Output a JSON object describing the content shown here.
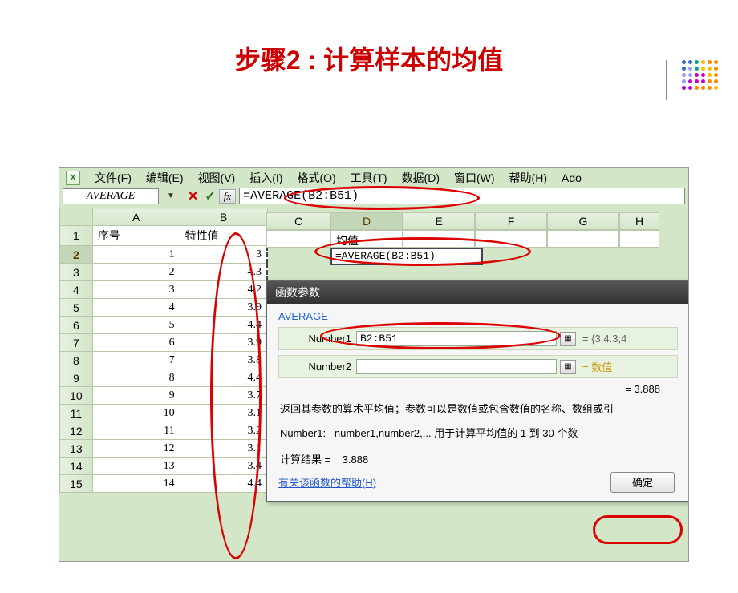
{
  "slide": {
    "title": "步骤2 : 计算样本的均值"
  },
  "menu": {
    "file": "文件(F)",
    "edit": "编辑(E)",
    "view": "视图(V)",
    "insert": "插入(I)",
    "format": "格式(O)",
    "tools": "工具(T)",
    "data": "数据(D)",
    "window": "窗口(W)",
    "help": "帮助(H)",
    "ado": "Ado"
  },
  "formulabar": {
    "namebox": "AVERAGE",
    "fx": "fx",
    "formula": "=AVERAGE(B2:B51)"
  },
  "cols": {
    "A": "A",
    "B": "B",
    "C": "C",
    "D": "D",
    "E": "E",
    "F": "F",
    "G": "G",
    "H": "H"
  },
  "headers": {
    "col_a": "序号",
    "col_b": "特性值",
    "col_d": "均值"
  },
  "cell_d2": "=AVERAGE(B2:B51)",
  "rows": [
    {
      "n": "1"
    },
    {
      "n": "2",
      "a": "1",
      "b": "3"
    },
    {
      "n": "3",
      "a": "2",
      "b": "4.3"
    },
    {
      "n": "4",
      "a": "3",
      "b": "4.2"
    },
    {
      "n": "5",
      "a": "4",
      "b": "3.9"
    },
    {
      "n": "6",
      "a": "5",
      "b": "4.4"
    },
    {
      "n": "7",
      "a": "6",
      "b": "3.9"
    },
    {
      "n": "8",
      "a": "7",
      "b": "3.8"
    },
    {
      "n": "9",
      "a": "8",
      "b": "4.4"
    },
    {
      "n": "10",
      "a": "9",
      "b": "3.7"
    },
    {
      "n": "11",
      "a": "10",
      "b": "3.1"
    },
    {
      "n": "12",
      "a": "11",
      "b": "3.2"
    },
    {
      "n": "13",
      "a": "12",
      "b": "3.1"
    },
    {
      "n": "14",
      "a": "13",
      "b": "3.4"
    },
    {
      "n": "15",
      "a": "14",
      "b": "4.4"
    }
  ],
  "dialog": {
    "title": "函数参数",
    "fn": "AVERAGE",
    "arg1_label": "Number1",
    "arg1_value": "B2:B51",
    "arg1_eval": "= {3;4.3;4",
    "arg2_label": "Number2",
    "arg2_value": "",
    "arg2_eval": "= 数值",
    "preview": "= 3.888",
    "desc": "返回其参数的算术平均值；参数可以是数值或包含数值的名称、数组或引",
    "argdesc_name": "Number1:",
    "argdesc_text": "number1,number2,... 用于计算平均值的 1 到 30 个数",
    "result_label": "计算结果 =",
    "result_value": "3.888",
    "help": "有关该函数的帮助(H)",
    "ok": "确定"
  }
}
